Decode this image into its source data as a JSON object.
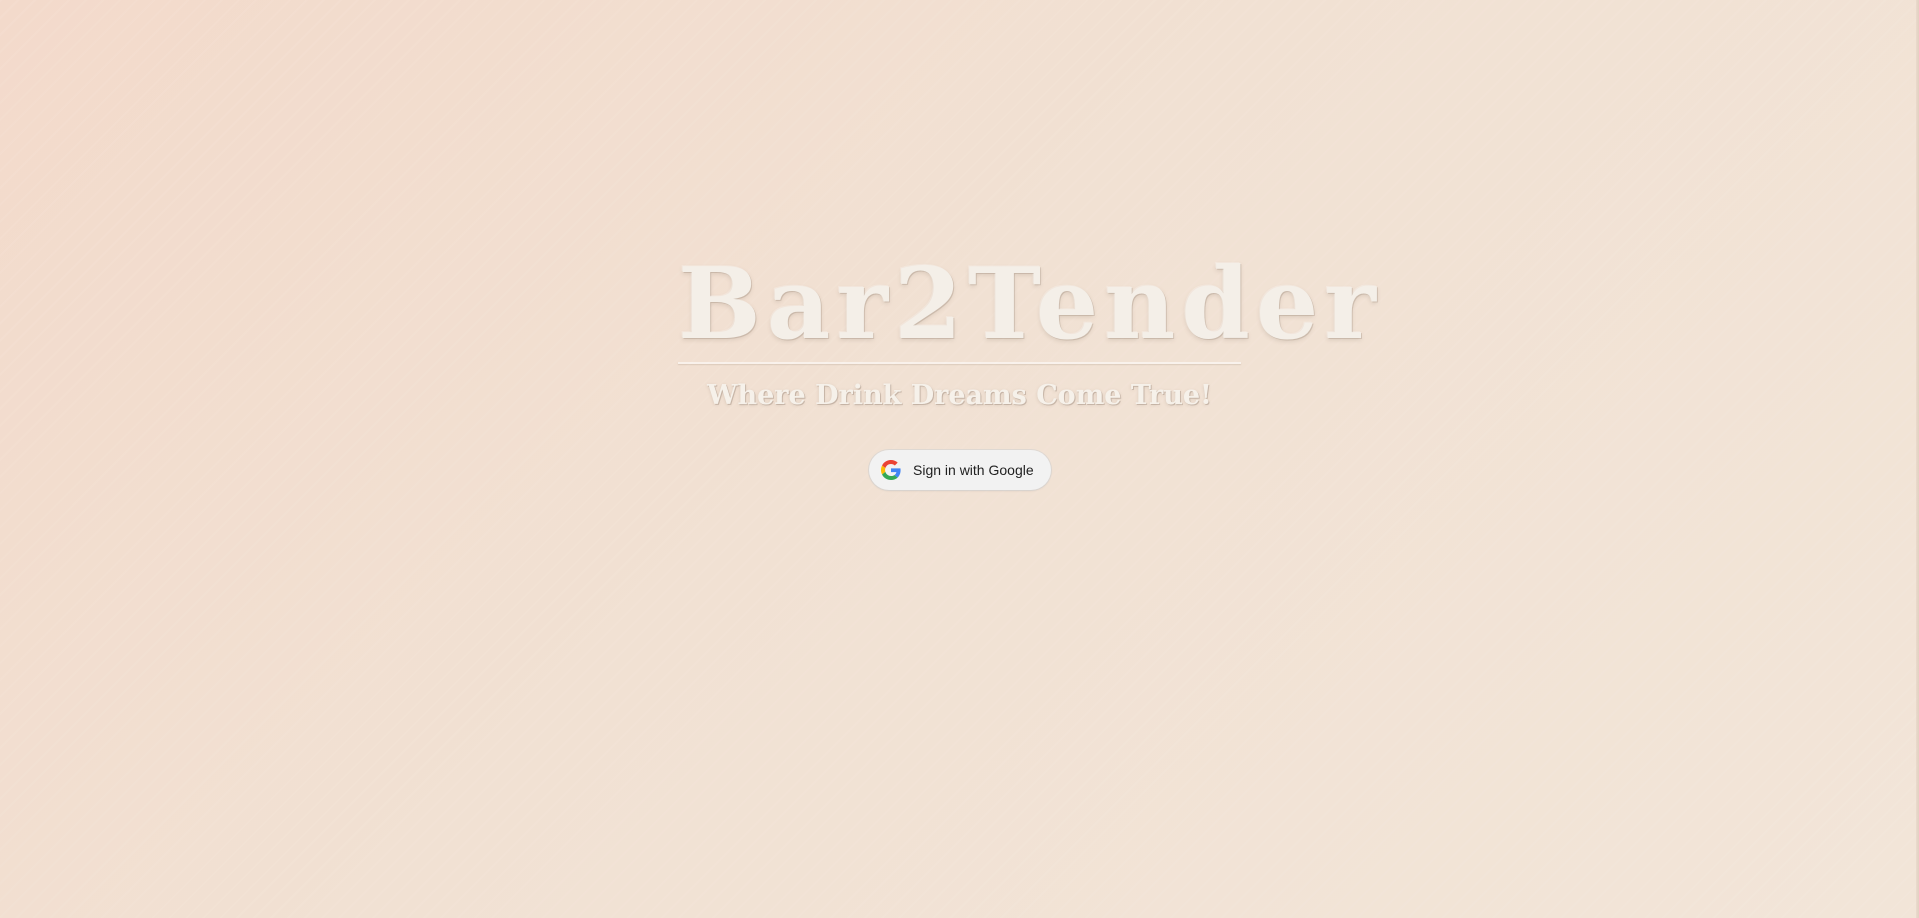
{
  "page": {
    "background_colors": [
      "#f3dacb",
      "#f1e1d3",
      "#f2e5d8"
    ]
  },
  "hero": {
    "title": "Bar2Tender",
    "tagline": "Where Drink Dreams Come True!"
  },
  "auth": {
    "google_button_label": "Sign in with Google",
    "icon": "google-g-icon"
  }
}
